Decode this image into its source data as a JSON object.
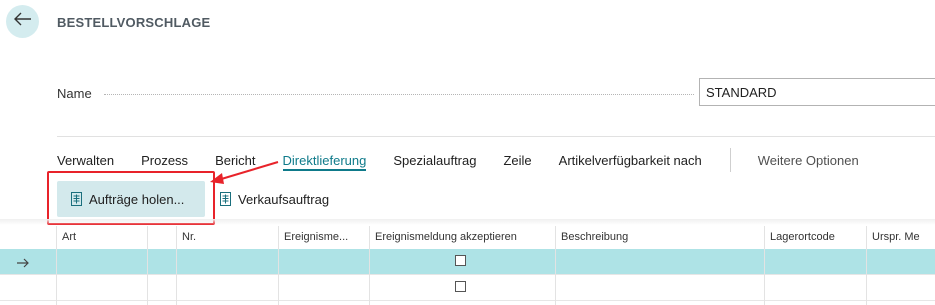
{
  "page": {
    "title": "BESTELLVORSCHLAGE",
    "back_icon": "arrow-left-icon"
  },
  "header": {
    "name_label": "Name",
    "name_value": "STANDARD"
  },
  "menu": {
    "items": [
      "Verwalten",
      "Prozess",
      "Bericht",
      "Direktlieferung",
      "Spezialauftrag",
      "Zeile",
      "Artikelverfügbarkeit nach"
    ],
    "active": "Direktlieferung",
    "more": "Weitere Optionen"
  },
  "actions": {
    "get_orders": "Aufträge holen...",
    "sales_order": "Verkaufsauftrag",
    "icon": "document-icon"
  },
  "grid": {
    "columns": [
      "Art",
      "Nr.",
      "Ereignisme...",
      "Ereignismeldung akzeptieren",
      "Beschreibung",
      "Lagerortcode",
      "Urspr. Me"
    ],
    "rows": [
      {
        "selected": true,
        "accepted": false
      },
      {
        "selected": false,
        "accepted": false
      }
    ]
  },
  "colors": {
    "accent": "#0e7a8a",
    "selected_row": "#aee3e6",
    "highlight": "#e8232a",
    "button_bg": "#d3e9ec"
  }
}
